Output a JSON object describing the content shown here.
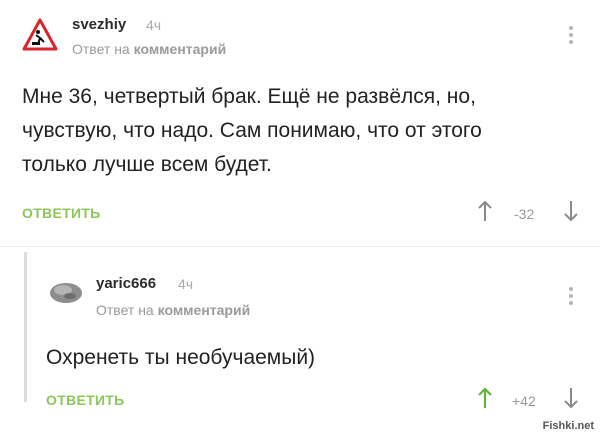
{
  "comments": [
    {
      "username": "svezhiy",
      "time": "4ч",
      "reply_prefix": "Ответ на",
      "reply_target": "комментарий",
      "lines": [
        "Мне 36, четвертый брак. Ещё не развёлся, но,",
        "чувствую, что надо. Сам понимаю, что от этого",
        "только лучше всем будет."
      ],
      "action_label": "ОТВЕТИТЬ",
      "rating": "-32",
      "avatar_icon": "warning-sign-icon"
    },
    {
      "username": "yaric666",
      "time": "4ч",
      "reply_prefix": "Ответ на",
      "reply_target": "комментарий",
      "lines": [
        "Охренеть ты необучаемый)"
      ],
      "action_label": "ОТВЕТИТЬ",
      "rating": "+42",
      "avatar_icon": "rock-avatar-icon"
    }
  ],
  "watermark": "Fishki.net",
  "colors": {
    "accent": "#8ac858",
    "muted": "#9a9a9a"
  }
}
